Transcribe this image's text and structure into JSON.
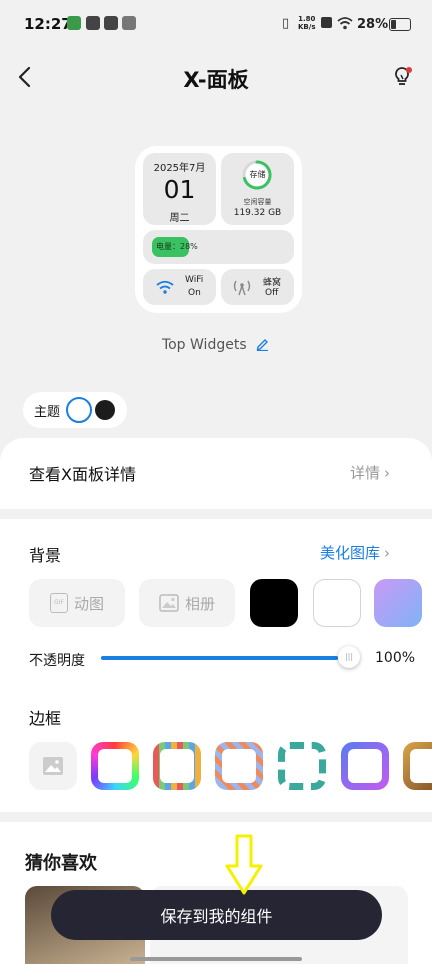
{
  "status_bar": {
    "time": "12:27",
    "net_speed": "1.80",
    "net_unit": "KB/s",
    "battery": "28%"
  },
  "header": {
    "title": "X-面板"
  },
  "widget": {
    "date": "2025年7月",
    "day": "01",
    "weekday": "周二",
    "storage_label": "存储",
    "storage_free_label": "空闲容量",
    "storage_free_value": "119.32 GB",
    "battery_label": "电量：28%",
    "battery_level": 0.28,
    "wifi_label": "WiFi",
    "wifi_state": "On",
    "cellular_label": "蜂窝",
    "cellular_state": "Off",
    "name": "Top Widgets"
  },
  "theme": {
    "label": "主题"
  },
  "details": {
    "title": "查看X面板详情",
    "link": "详情"
  },
  "background": {
    "title": "背景",
    "link": "美化图库",
    "options": [
      "动图",
      "相册"
    ],
    "opacity_label": "不透明度",
    "opacity_value": "100%",
    "opacity_level": 1.0
  },
  "border": {
    "title": "边框"
  },
  "recommend": {
    "title": "猜你喜欢"
  },
  "save_button": "保存到我的组件",
  "colors": {
    "accent": "#1a7fe0",
    "battery_green": "#3ac161",
    "save_bg": "#262533",
    "arrow": "#f5f000"
  }
}
